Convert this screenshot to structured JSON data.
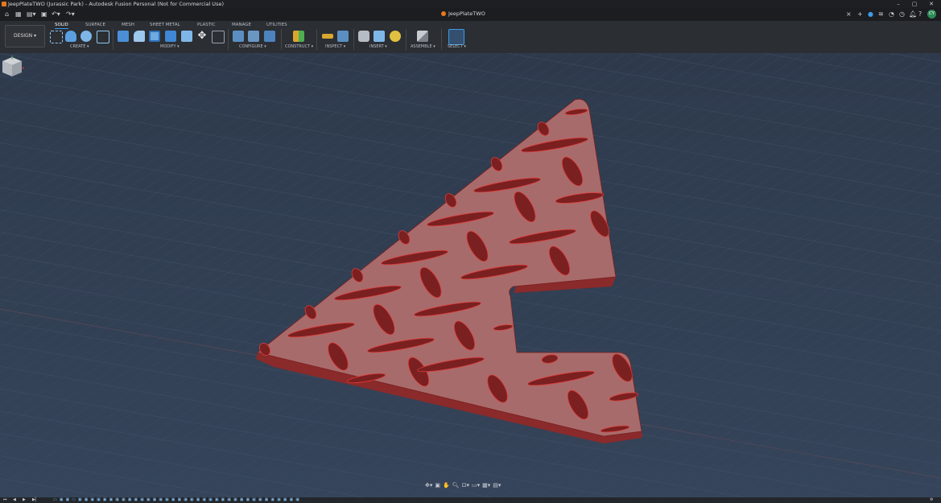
{
  "window": {
    "title": "JeepPlateTWO (Jurassic Park) - Autodesk Fusion Personal (Not for Commercial Use)",
    "minimize": "–",
    "maximize": "▢",
    "close": "✕"
  },
  "document_tab": {
    "label": "JeepPlateTWO",
    "close": "×"
  },
  "workspace": {
    "label": "DESIGN ▾"
  },
  "ribbon_tabs": [
    {
      "label": "SOLID",
      "active": true
    },
    {
      "label": "SURFACE"
    },
    {
      "label": "MESH"
    },
    {
      "label": "SHEET METAL"
    },
    {
      "label": "PLASTIC"
    },
    {
      "label": "MANAGE"
    },
    {
      "label": "UTILITIES"
    }
  ],
  "tool_groups": [
    {
      "label": "CREATE ▾"
    },
    {
      "label": "MODIFY ▾"
    },
    {
      "label": "CONFIGURE ▾"
    },
    {
      "label": "CONSTRUCT ▾"
    },
    {
      "label": "INSPECT ▾"
    },
    {
      "label": "INSERT ▾"
    },
    {
      "label": "ASSEMBLE ▾"
    },
    {
      "label": "SELECT ▾"
    }
  ],
  "user": {
    "initials": "CY"
  },
  "colors": {
    "accent": "#3c9be6",
    "plate_top": "#a86b6b",
    "plate_side": "#8a2a2a",
    "diamond": "#7a2020",
    "diamond_highlight": "#e03a3a"
  }
}
